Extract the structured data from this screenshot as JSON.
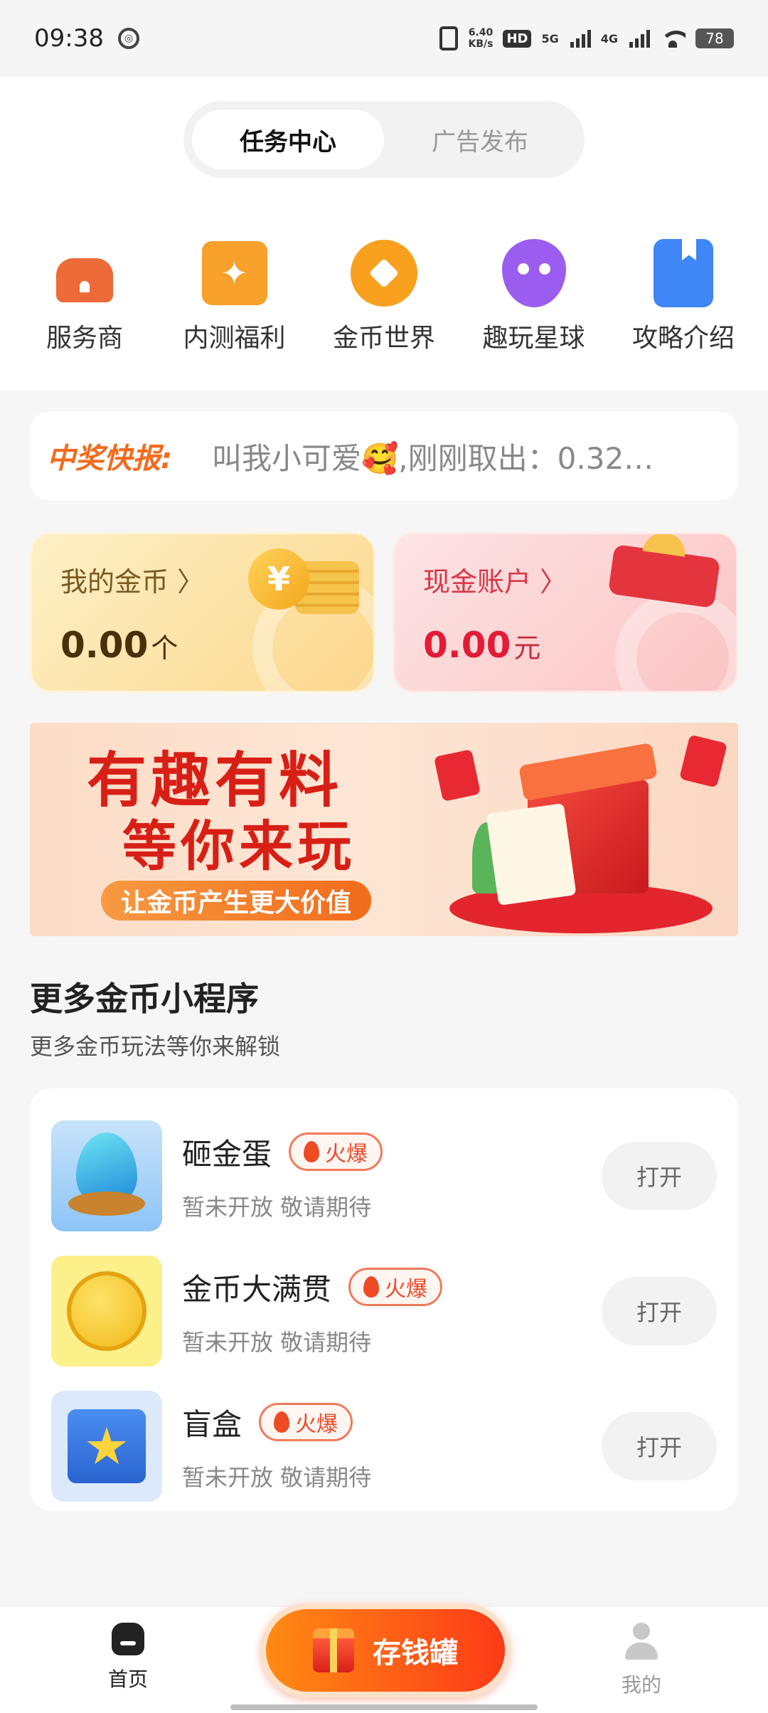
{
  "status_bar": {
    "time": "09:38",
    "net_speed": "6.40",
    "net_speed_unit": "KB/s",
    "hd": "HD",
    "sim1": "5G",
    "sim2": "4G",
    "battery": "78"
  },
  "segmented": {
    "tabs": [
      "任务中心",
      "广告发布"
    ],
    "active_index": 0
  },
  "quick_entries": [
    {
      "label": "服务商",
      "icon": "house-icon",
      "color": "#ee6a38"
    },
    {
      "label": "内测福利",
      "icon": "gift-star-icon",
      "color": "#f7a02a"
    },
    {
      "label": "金币世界",
      "icon": "coin-diamond-icon",
      "color": "#f9a01f"
    },
    {
      "label": "趣玩星球",
      "icon": "alien-icon",
      "color": "#9b5cf0"
    },
    {
      "label": "攻略介绍",
      "icon": "bookmark-icon",
      "color": "#3f86f7"
    }
  ],
  "ticker": {
    "label": "中奖快报:",
    "text": "叫我小可爱🥰,刚刚取出：0.32…"
  },
  "accounts": {
    "coins": {
      "title": "我的金币 〉",
      "value": "0.00",
      "unit": "个"
    },
    "cash": {
      "title": "现金账户 〉",
      "value": "0.00",
      "unit": "元"
    }
  },
  "banner": {
    "line1": "有趣有料",
    "line2": "等你来玩",
    "pill": "让金币产生更大价值"
  },
  "section": {
    "title": "更多金币小程序",
    "subtitle": "更多金币玩法等你来解锁"
  },
  "mini_programs": [
    {
      "name": "砸金蛋",
      "badge": "火爆",
      "desc": "暂未开放 敬请期待",
      "button": "打开"
    },
    {
      "name": "金币大满贯",
      "badge": "火爆",
      "desc": "暂未开放 敬请期待",
      "button": "打开"
    },
    {
      "name": "盲盒",
      "badge": "火爆",
      "desc": "暂未开放 敬请期待",
      "button": "打开"
    }
  ],
  "tabbar": {
    "home": "首页",
    "center": "存钱罐",
    "mine": "我的"
  }
}
